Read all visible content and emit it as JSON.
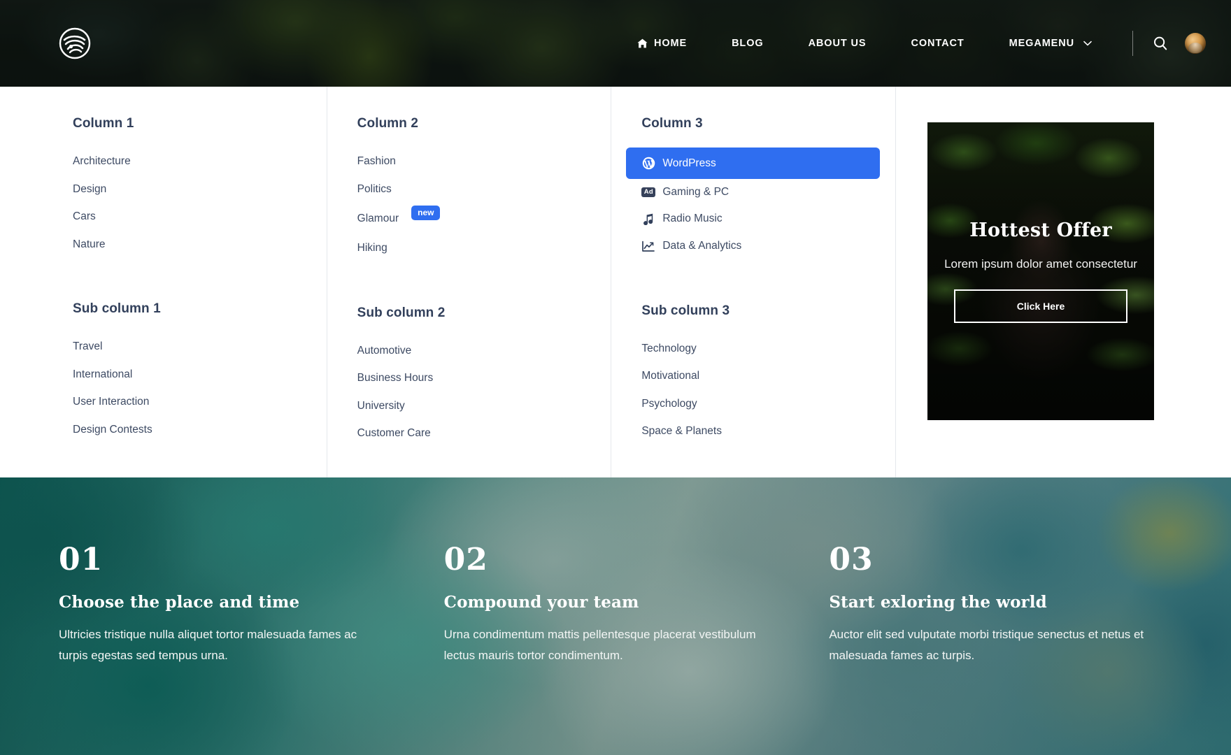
{
  "header": {
    "logo_icon": "wave-circle-logo",
    "nav": [
      {
        "label": "HOME",
        "icon": "home-icon",
        "has_caret": false
      },
      {
        "label": "BLOG",
        "icon": null,
        "has_caret": false
      },
      {
        "label": "ABOUT US",
        "icon": null,
        "has_caret": false
      },
      {
        "label": "CONTACT",
        "icon": null,
        "has_caret": false
      },
      {
        "label": "MEGAMENU",
        "icon": null,
        "has_caret": true
      }
    ],
    "search_icon": "search-icon",
    "avatar_icon": "user-avatar"
  },
  "megamenu": {
    "columns": [
      {
        "title": "Column 1",
        "links": [
          {
            "label": "Architecture"
          },
          {
            "label": "Design"
          },
          {
            "label": "Cars"
          },
          {
            "label": "Nature"
          }
        ],
        "sub_title": "Sub column 1",
        "sub_links": [
          {
            "label": "Travel"
          },
          {
            "label": "International"
          },
          {
            "label": "User Interaction"
          },
          {
            "label": "Design Contests"
          }
        ]
      },
      {
        "title": "Column 2",
        "links": [
          {
            "label": "Fashion"
          },
          {
            "label": "Politics"
          },
          {
            "label": "Glamour",
            "badge": "new"
          },
          {
            "label": "Hiking"
          }
        ],
        "sub_title": "Sub column 2",
        "sub_links": [
          {
            "label": "Automotive"
          },
          {
            "label": "Business Hours"
          },
          {
            "label": "University"
          },
          {
            "label": "Customer Care"
          }
        ]
      },
      {
        "title": "Column 3",
        "links": [
          {
            "label": "WordPress",
            "icon": "wordpress-icon",
            "highlighted": true
          },
          {
            "label": "Gaming & PC",
            "icon": "ad-badge-icon"
          },
          {
            "label": "Radio Music",
            "icon": "music-note-icon"
          },
          {
            "label": "Data & Analytics",
            "icon": "chart-line-icon"
          }
        ],
        "sub_title": "Sub column 3",
        "sub_links": [
          {
            "label": "Technology"
          },
          {
            "label": "Motivational"
          },
          {
            "label": "Psychology"
          },
          {
            "label": "Space & Planets"
          }
        ]
      }
    ],
    "promo": {
      "title": "Hottest Offer",
      "subtitle": "Lorem ipsum dolor amet consectetur",
      "button_label": "Click Here"
    },
    "accent_color": "#2f6ef0",
    "badge_color": "#2f6ef0",
    "heading_color": "#32405b",
    "link_color": "#3d4a63"
  },
  "features": [
    {
      "number": "01",
      "title": "Choose the place and time",
      "body": "Ultricies tristique nulla aliquet tortor malesuada fames ac turpis egestas sed tempus urna."
    },
    {
      "number": "02",
      "title": "Compound your team",
      "body": "Urna condimentum mattis pellentesque placerat vestibulum lectus mauris tortor condimentum."
    },
    {
      "number": "03",
      "title": "Start exloring the world",
      "body": "Auctor elit sed vulputate morbi tristique senectus et netus et malesuada fames ac turpis."
    }
  ]
}
